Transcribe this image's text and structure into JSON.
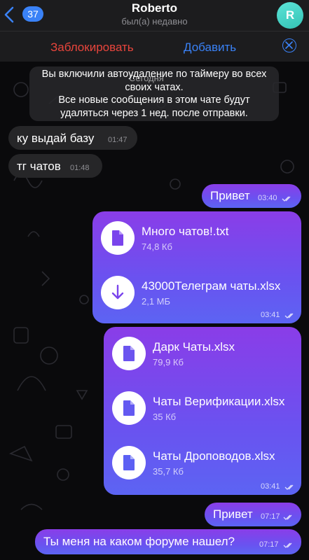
{
  "header": {
    "back_count": "37",
    "title": "Roberto",
    "status": "был(а) недавно",
    "avatar_letter": "R"
  },
  "action_bar": {
    "block_label": "Заблокировать",
    "add_label": "Добавить"
  },
  "service_message": {
    "line1": "Вы включили автоудаление по таймеру во всех",
    "line2": "своих чатах.",
    "line3": "Все новые сообщения в этом чате будут",
    "line4": "удаляться через 1 нед. после отправки.",
    "date_chip": "Сегодня"
  },
  "messages": {
    "in1": {
      "text": "ку выдай базу",
      "time": "01:47"
    },
    "in2": {
      "text": "тг чатов",
      "time": "01:48"
    },
    "out1": {
      "text": "Привет",
      "time": "03:40"
    },
    "files1": {
      "time": "03:41",
      "items": [
        {
          "name": "Много чатов!.txt",
          "size": "74,8 Кб",
          "icon": "document-icon"
        },
        {
          "name": "43000Телеграм чаты.xlsx",
          "size": "2,1 МБ",
          "icon": "download-icon"
        }
      ]
    },
    "files2": {
      "time": "03:41",
      "items": [
        {
          "name": "Дарк Чаты.xlsx",
          "size": "79,9 Кб",
          "icon": "document-icon"
        },
        {
          "name": "Чаты Верификации.xlsx",
          "size": "35 Кб",
          "icon": "document-icon"
        },
        {
          "name": "Чаты Дроповодов.xlsx",
          "size": "35,7 Кб",
          "icon": "document-icon"
        }
      ]
    },
    "out2": {
      "text": "Привет",
      "time": "07:17"
    },
    "out3": {
      "text": "Ты меня на каком форуме нашел?",
      "time": "07:17"
    }
  },
  "colors": {
    "accent": "#3a82f7",
    "destructive": "#e8453c",
    "outgoing_top": "#8a3de8",
    "outgoing_bottom": "#5c64f3",
    "avatar": "#4fd6c9"
  }
}
